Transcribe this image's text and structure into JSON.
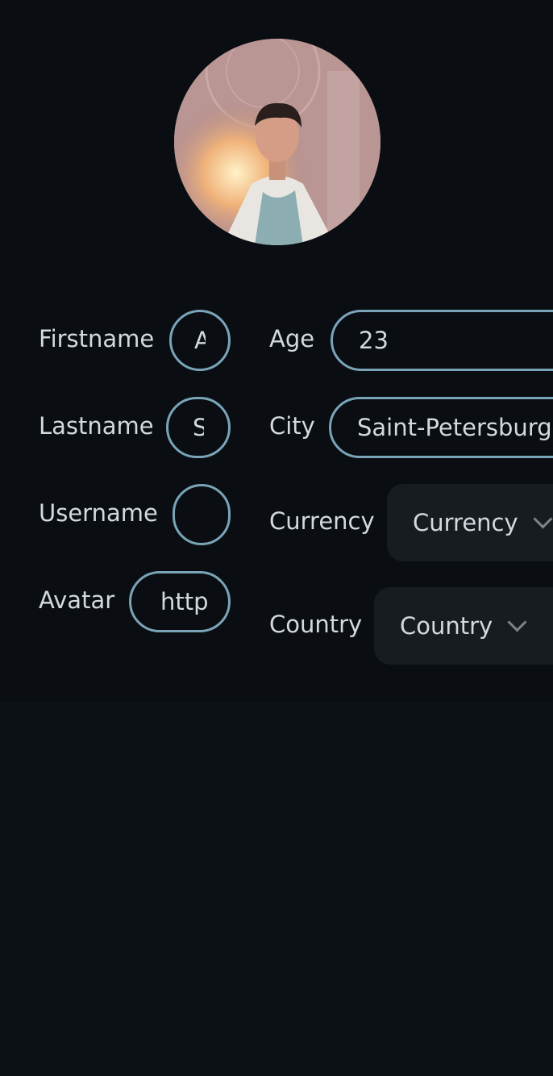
{
  "profile": {
    "avatar_alt": "Profile avatar",
    "left_fields": [
      {
        "label": "Firstname",
        "value": "A"
      },
      {
        "label": "Lastname",
        "value": "S"
      },
      {
        "label": "Username",
        "value": ""
      },
      {
        "label": "Avatar",
        "value": "http"
      }
    ],
    "right_fields": {
      "age": {
        "label": "Age",
        "value": "23"
      },
      "city": {
        "label": "City",
        "value": "Saint-Petersburg"
      },
      "currency": {
        "label": "Currency",
        "selected": "Currency"
      },
      "country": {
        "label": "Country",
        "selected": "Country"
      }
    }
  },
  "icons": {
    "select_arrow": "chevron-down-icon"
  },
  "colors": {
    "background": "#0c1115",
    "card": "#0a0e12",
    "input_border": "#7aa4b7",
    "select_bg": "#161c20",
    "text": "#d3d9de"
  }
}
